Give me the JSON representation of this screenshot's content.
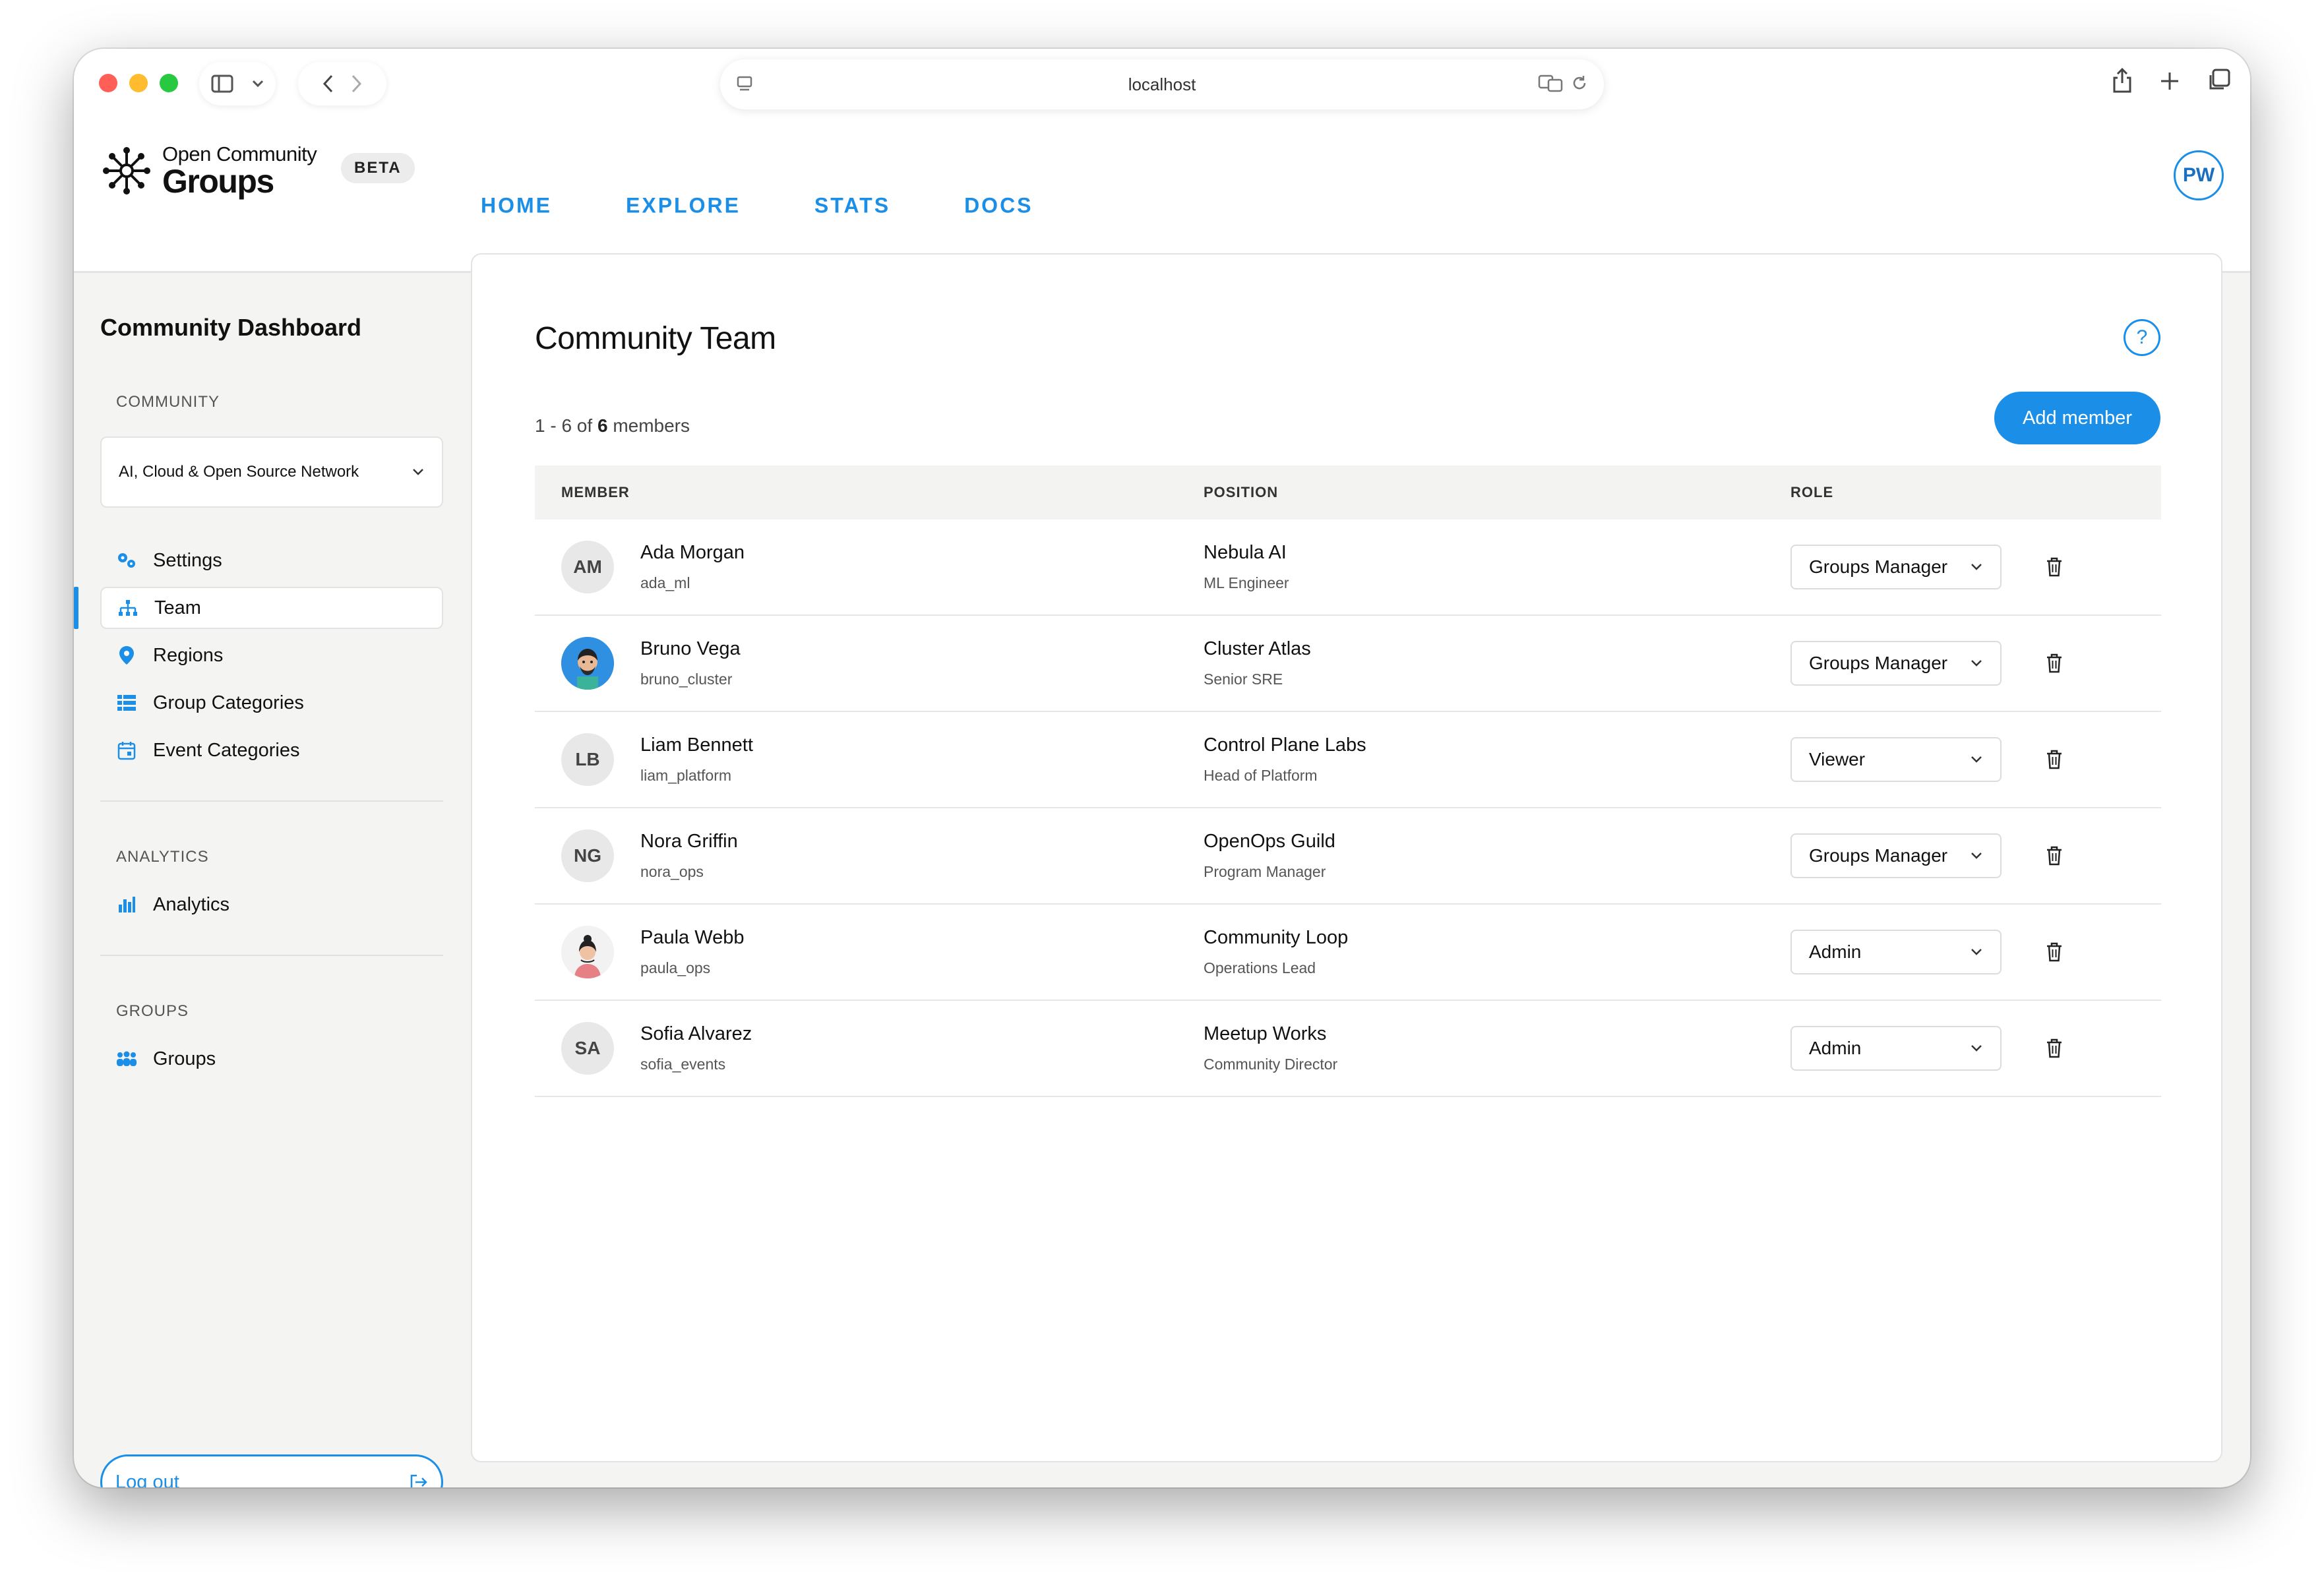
{
  "browser": {
    "url": "localhost"
  },
  "header": {
    "logo_small": "Open Community",
    "logo_big": "Groups",
    "beta": "BETA",
    "nav": [
      "HOME",
      "EXPLORE",
      "STATS",
      "DOCS"
    ],
    "user_initials": "PW"
  },
  "sidebar": {
    "title": "Community Dashboard",
    "community_section": "COMMUNITY",
    "community_selected": "AI, Cloud & Open Source Network",
    "items": [
      {
        "label": "Settings",
        "icon": "gears-icon"
      },
      {
        "label": "Team",
        "icon": "team-hierarchy-icon"
      },
      {
        "label": "Regions",
        "icon": "map-pin-icon"
      },
      {
        "label": "Group Categories",
        "icon": "list-icon"
      },
      {
        "label": "Event Categories",
        "icon": "calendar-icon"
      }
    ],
    "analytics_section": "ANALYTICS",
    "analytics_item": "Analytics",
    "groups_section": "GROUPS",
    "groups_item": "Groups",
    "logout": "Log out"
  },
  "main": {
    "title": "Community Team",
    "count_prefix": "1 - 6 of",
    "count_total": "6",
    "count_suffix": "members",
    "add_button": "Add member",
    "columns": {
      "member": "MEMBER",
      "position": "POSITION",
      "role": "ROLE"
    },
    "members": [
      {
        "initials": "AM",
        "name": "Ada Morgan",
        "username": "ada_ml",
        "company": "Nebula AI",
        "title": "ML Engineer",
        "role": "Groups Manager"
      },
      {
        "initials": "",
        "name": "Bruno Vega",
        "username": "bruno_cluster",
        "company": "Cluster Atlas",
        "title": "Senior SRE",
        "role": "Groups Manager"
      },
      {
        "initials": "LB",
        "name": "Liam Bennett",
        "username": "liam_platform",
        "company": "Control Plane Labs",
        "title": "Head of Platform",
        "role": "Viewer"
      },
      {
        "initials": "NG",
        "name": "Nora Griffin",
        "username": "nora_ops",
        "company": "OpenOps Guild",
        "title": "Program Manager",
        "role": "Groups Manager"
      },
      {
        "initials": "",
        "name": "Paula Webb",
        "username": "paula_ops",
        "company": "Community Loop",
        "title": "Operations Lead",
        "role": "Admin"
      },
      {
        "initials": "SA",
        "name": "Sofia Alvarez",
        "username": "sofia_events",
        "company": "Meetup Works",
        "title": "Community Director",
        "role": "Admin"
      }
    ]
  },
  "colors": {
    "accent": "#1b8fe7",
    "background": "#f4f4f3"
  }
}
